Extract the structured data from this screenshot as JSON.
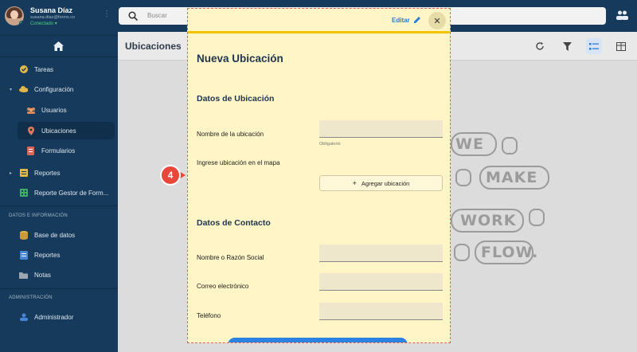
{
  "user": {
    "name": "Susana Díaz",
    "email": "susana.diaz@forms.co",
    "status": "Conectado"
  },
  "search": {
    "placeholder": "Buscar"
  },
  "page": {
    "title": "Ubicaciones"
  },
  "sidebar": {
    "items": [
      {
        "label": "Tareas"
      },
      {
        "label": "Configuración"
      },
      {
        "label": "Usuarios"
      },
      {
        "label": "Ubicaciones"
      },
      {
        "label": "Formularios"
      },
      {
        "label": "Reportes"
      },
      {
        "label": "Reporte Gestor de Form..."
      }
    ],
    "section_data": "DATOS E INFORMACIÓN",
    "data_items": [
      {
        "label": "Base de datos"
      },
      {
        "label": "Reportes"
      },
      {
        "label": "Notas"
      }
    ],
    "section_admin": "ADMINISTRACIÓN",
    "admin_items": [
      {
        "label": "Administrador"
      }
    ]
  },
  "modal": {
    "edit_label": "Editar",
    "title": "Nueva Ubicación",
    "section_location": "Datos de Ubicación",
    "location_name_label": "Nombre de la ubicación",
    "required_hint": "Obligatorio",
    "map_label": "Ingrese ubicación en el mapa",
    "add_location_label": "Agregar ubicación",
    "section_contact": "Datos de Contacto",
    "name_label": "Nombre o Razón Social",
    "email_label": "Correo electrónico",
    "phone_label": "Teléfono"
  },
  "step_badge": "4",
  "illustration": {
    "words": [
      "WE",
      "MAKE",
      "WORK",
      "FLOW."
    ]
  },
  "colors": {
    "sidebar": "#153a5b",
    "modal_bg": "#fff5c7",
    "accent_yellow": "#f2c200",
    "badge": "#e8483a",
    "link": "#2b7bd3"
  }
}
